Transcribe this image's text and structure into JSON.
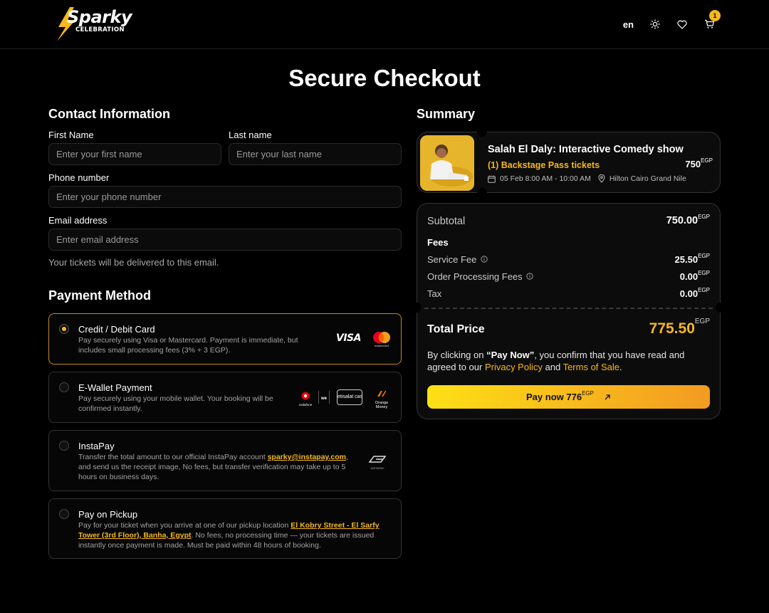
{
  "header": {
    "logo_text": "Sparky",
    "logo_sub": "CELEBRATION",
    "lang": "en",
    "cart_count": "1"
  },
  "page_title": "Secure Checkout",
  "contact": {
    "title": "Contact Information",
    "first_name_label": "First Name",
    "first_name_placeholder": "Enter your first name",
    "last_name_label": "Last name",
    "last_name_placeholder": "Enter your last name",
    "phone_label": "Phone number",
    "phone_placeholder": "Enter your phone number",
    "email_label": "Email address",
    "email_placeholder": "Enter email address",
    "email_help": "Your tickets will be delivered to this email."
  },
  "payment": {
    "title": "Payment Method",
    "options": [
      {
        "title": "Credit / Debit Card",
        "desc": "Pay securely using Visa or Mastercard. Payment is immediate, but includes small processing fees (3% + 3 EGP).",
        "selected": true,
        "logos": [
          "VISA",
          "mastercard"
        ]
      },
      {
        "title": "E-Wallet Payment",
        "desc": "Pay securely using your mobile wallet. Your booking will be confirmed instantly.",
        "selected": false,
        "logos": [
          "vodafone",
          "we",
          "etisalat cash",
          "Orange Money"
        ]
      },
      {
        "title": "InstaPay",
        "desc_before": "Transfer the total amount to our official InstaPay account",
        "desc_link": "sparky@instapay.com",
        "desc_after": ", and send us the receipt image, No fees, but transfer verification may take up to 5 hours on business days.",
        "selected": false,
        "logos": [
          "INSTAPAY"
        ]
      },
      {
        "title": "Pay on Pickup",
        "desc_before": "Pay for your ticket when you arrive at one of our pickup location ",
        "desc_link": "El Kobry Street - El Sarfy Tower (3rd Floor), Banha, Egypt",
        "desc_after": ". No fees, no processing time — your tickets are issued instantly once payment is made. Must be paid within 48 hours of booking.",
        "selected": false
      }
    ]
  },
  "summary": {
    "title": "Summary",
    "event": {
      "title": "Salah El Daly: Interactive Comedy show",
      "tickets": "(1) Backstage Pass tickets",
      "price": "750",
      "currency": "EGP",
      "datetime": "05 Feb 8:00 AM - 10:00 AM",
      "venue": "Hilton Cairo Grand Nile"
    },
    "subtotal_label": "Subtotal",
    "subtotal": "750.00",
    "fees_label": "Fees",
    "service_fee_label": "Service Fee",
    "service_fee": "25.50",
    "processing_label": "Order Processing Fees",
    "processing": "0.00",
    "tax_label": "Tax",
    "tax": "0.00",
    "total_label": "Total Price",
    "total": "775.50",
    "currency": "EGP",
    "legal_pre": "By clicking on ",
    "legal_bold": "“Pay Now”",
    "legal_mid": ", you confirm that you have read and agreed to our ",
    "privacy": "Privacy Policy",
    "and": " and ",
    "terms": "Terms of Sale",
    "period": ".",
    "pay_label": "Pay now 776",
    "pay_currency": "EGP"
  },
  "colors": {
    "accent": "#f6b81f",
    "background": "#000000"
  }
}
